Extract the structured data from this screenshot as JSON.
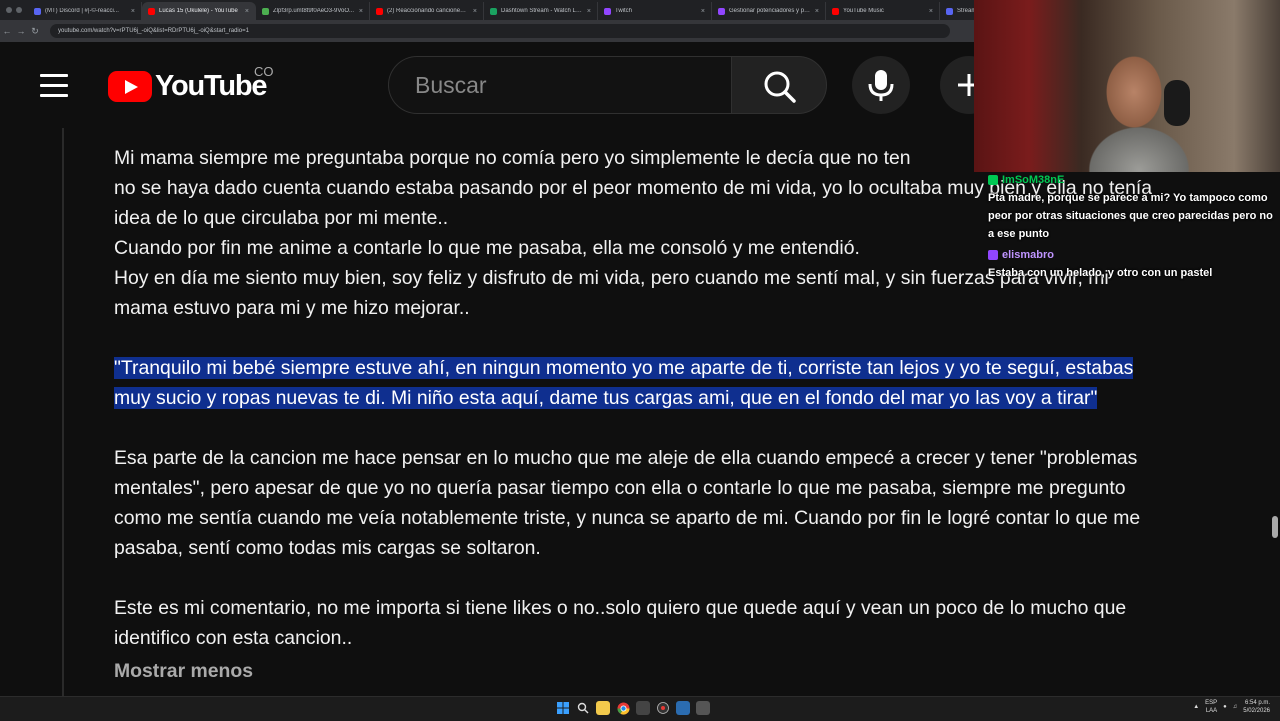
{
  "browser": {
    "tabs": [
      {
        "title": "(MT) Discord | #|-©-reacci...",
        "color": "#5865f2",
        "active": false
      },
      {
        "title": "Lucas 15 (Ukulele) - YouTube",
        "color": "#ff0000",
        "active": true
      },
      {
        "title": "Zlpf3rp.umt8t9f0AeO3-9VoO...",
        "color": "#4caf50",
        "active": false
      },
      {
        "title": "(2) Reaccionando canciones q...",
        "color": "#ff0000",
        "active": false
      },
      {
        "title": "Dashtown Stream - Watch Liv...",
        "color": "#1aa260",
        "active": false
      },
      {
        "title": "Twitch",
        "color": "#9146ff",
        "active": false
      },
      {
        "title": "Gestionar potenciadores y pu...",
        "color": "#9146ff",
        "active": false
      },
      {
        "title": "YouTube Music",
        "color": "#ff0000",
        "active": false
      },
      {
        "title": "Stream",
        "color": "#5865f2",
        "active": false
      }
    ],
    "url": "youtube.com/watch?v=rPTU6j_-oiQ&list=RDrPTU6j_-oiQ&start_radio=1"
  },
  "header": {
    "logo_text": "YouTube",
    "country_code": "CO",
    "search_placeholder": "Buscar"
  },
  "overlay": {
    "chat": [
      {
        "user": "ImSoM38nE",
        "user_color": "#00c853",
        "message": "Pta madre, porque se parece a mi? Yo tampoco como peor por otras situaciones que creo parecidas pero no a ese punto"
      },
      {
        "user": "elismabro",
        "user_color": "#bf94ff",
        "message": "Estaba con un helado, y otro con un pastel"
      }
    ]
  },
  "comment": {
    "para1": [
      "Mi mama siempre me preguntaba porque no comía pero yo simplemente le decía que no ten",
      "no se haya dado cuenta cuando estaba pasando por el peor momento de mi vida, yo lo ocultaba muy bien y ella no tenía",
      "idea de lo que circulaba por mi mente..",
      "Cuando por fin me anime a contarle lo que me pasaba, ella me consoló y me entendió.",
      "Hoy en día me siento muy bien, soy feliz y disfruto de mi vida, pero cuando me sentí mal, y sin fuerzas para vivir, mi",
      "mama estuvo para mi y me hizo mejorar.."
    ],
    "quote": [
      "\"Tranquilo mi bebé siempre estuve ahí, en ningun momento yo me aparte de ti, corriste tan lejos y yo te seguí, estabas",
      "muy sucio y ropas nuevas te di. Mi niño esta aquí, dame tus cargas ami, que en el fondo del mar yo las voy a tirar\""
    ],
    "para2": [
      "Esa parte de la cancion me hace pensar en lo mucho que me aleje de ella cuando empecé a crecer y tener \"problemas",
      "mentales\", pero apesar de que yo no quería pasar tiempo con ella o contarle lo que me pasaba, siempre me pregunto",
      "como me sentía cuando me veía notablemente triste, y nunca se aparto de mi. Cuando por fin le logré contar lo que me",
      "pasaba, sentí como todas mis cargas se soltaron."
    ],
    "para3": [
      "Este es mi comentario, no me importa si tiene likes o no..solo quiero que quede aquí y vean un poco de lo mucho que",
      "identifico con esta cancion.."
    ],
    "show_less": "Mostrar menos"
  },
  "taskbar": {
    "lang": "ESP",
    "lang_sub": "LAA",
    "time": "6:54 p.m.",
    "date": "5/02/2026"
  }
}
